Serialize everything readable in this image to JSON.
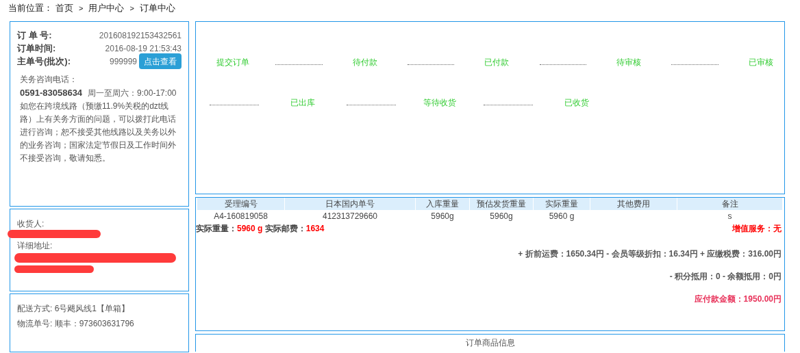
{
  "breadcrumb": {
    "label": "当前位置：",
    "items": [
      "首页",
      "用户中心",
      "订单中心"
    ],
    "separator": ">"
  },
  "order_info": {
    "fields": [
      {
        "label": "订 单 号:",
        "value": "201608192153432561"
      },
      {
        "label": "订单时间:",
        "value": "2016-08-19 21:53:43"
      },
      {
        "label": "主单号(批次):",
        "value": "999999",
        "button": "点击查看"
      }
    ],
    "hotline_label": "关务咨询电话：",
    "phone": "0591-83058634",
    "hours": "周一至周六：9:00-17:00",
    "notice": "如您在跨境线路（预缴11.9%关税的dzt线路）上有关务方面的问题，可以拨打此电话进行咨询；恕不接受其他线路以及关务以外的业务咨询；国家法定节假日及工作时间外不接受咨询，敬请知悉。"
  },
  "consignee": {
    "fields": [
      "收货人:",
      "详细地址:"
    ]
  },
  "shipping": {
    "lines": [
      "配送方式: 6号飓风线1【单箱】",
      "物流单号: 顺丰：973603631796"
    ]
  },
  "progress": {
    "rows": [
      [
        "提交订单",
        "待付款",
        "已付款",
        "待审核",
        "已审核"
      ],
      [
        "已出库",
        "等待收货",
        "已收货"
      ]
    ]
  },
  "table": {
    "columns": [
      "受理编号",
      "日本国内单号",
      "入库重量",
      "预估发货重量",
      "实际重量",
      "其他费用",
      "备注"
    ],
    "rows": [
      [
        "A4-160819058",
        "412313729660",
        "5960g",
        "5960g",
        "5960 g",
        "",
        "s"
      ]
    ]
  },
  "summary": {
    "weight_label": "实际重量：",
    "weight": "5960 g",
    "postage_label": "实际邮费：",
    "postage": "1634",
    "service_label": "增值服务：",
    "service": "无",
    "fee_lines": [
      "+ 折前运费：1650.34円 - 会员等级折扣：16.34円 + 应缴税费：316.00円",
      "- 积分抵用：0 - 余额抵用：0円"
    ],
    "total": "应付款金额：1950.00円"
  },
  "goods_panel": {
    "title": "订单商品信息"
  }
}
